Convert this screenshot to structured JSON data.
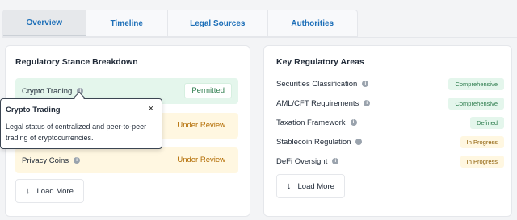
{
  "tabs": [
    {
      "label": "Overview"
    },
    {
      "label": "Timeline"
    },
    {
      "label": "Legal Sources"
    },
    {
      "label": "Authorities"
    }
  ],
  "stance": {
    "title": "Regulatory Stance Breakdown",
    "items": [
      {
        "label": "Crypto Trading",
        "status": "Permitted"
      },
      {
        "label": "",
        "status": "Under Review"
      },
      {
        "label": "Privacy Coins",
        "status": "Under Review"
      }
    ],
    "load_more": "Load More"
  },
  "areas": {
    "title": "Key Regulatory Areas",
    "items": [
      {
        "label": "Securities Classification",
        "status": "Comprehensive"
      },
      {
        "label": "AML/CFT Requirements",
        "status": "Comprehensive"
      },
      {
        "label": "Taxation Framework",
        "status": "Defined"
      },
      {
        "label": "Stablecoin Regulation",
        "status": "In Progress"
      },
      {
        "label": "DeFi Oversight",
        "status": "In Progress"
      }
    ],
    "load_more": "Load More"
  },
  "tooltip": {
    "title": "Crypto Trading",
    "body": "Legal status of centralized and peer-to-peer trading of cryptocurrencies.",
    "close": "×"
  },
  "colors": {
    "accent": "#1d6fb8",
    "permitted_bg": "#e4f6ec",
    "review_bg": "#fff7e1"
  }
}
